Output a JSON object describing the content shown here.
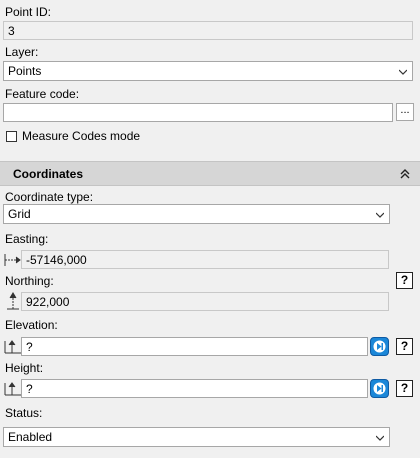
{
  "point": {
    "id_label": "Point ID:",
    "id_value": "3",
    "layer_label": "Layer:",
    "layer_value": "Points",
    "feature_code_label": "Feature code:",
    "feature_code_value": "",
    "ellipsis_label": "...",
    "measure_codes_label": "Measure Codes mode",
    "measure_codes_checked": false
  },
  "coordinates": {
    "section_title": "Coordinates",
    "type_label": "Coordinate type:",
    "type_value": "Grid",
    "easting_label": "Easting:",
    "easting_value": "-57146,000",
    "northing_label": "Northing:",
    "northing_value": "922,000",
    "elevation_label": "Elevation:",
    "elevation_value": "?",
    "height_label": "Height:",
    "height_value": "?",
    "status_label": "Status:",
    "status_value": "Enabled",
    "help_label": "?"
  },
  "icons": {
    "collapse": "double-chevron-up-icon",
    "dropdown": "chevron-down-icon",
    "easting": "easting-arrow-icon",
    "northing": "northing-arrow-icon",
    "elevation": "elevation-icon",
    "height": "height-icon",
    "skip": "skip-forward-icon"
  },
  "colors": {
    "accent_blue": "#1b87d8",
    "section_bg": "#d6d6d6",
    "panel_bg": "#f0f0f0"
  }
}
